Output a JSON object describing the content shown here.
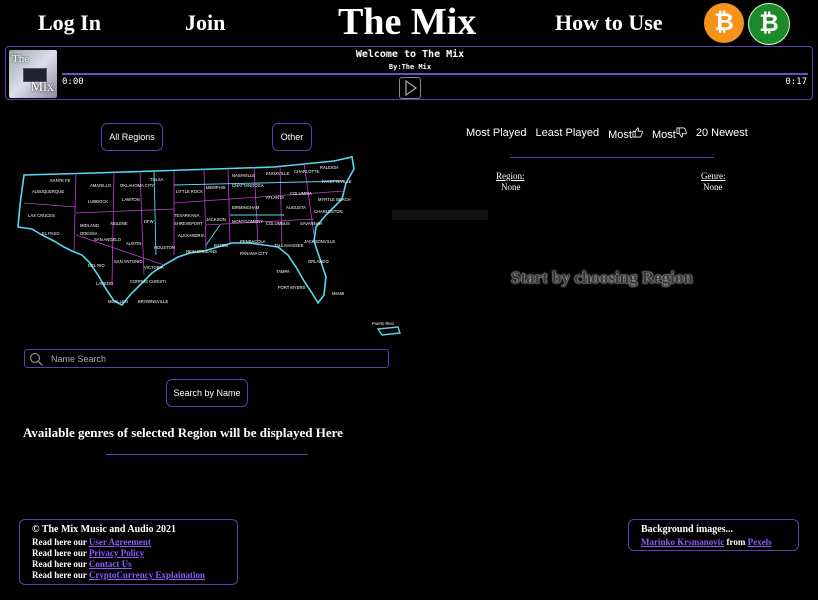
{
  "header": {
    "login": "Log In",
    "join": "Join",
    "title": "The Mix",
    "how_to_use": "How to Use",
    "bitcoin_symbol": "₿",
    "bitcoin_cash_symbol": "₿",
    "bitcoin_color": "#f7931a",
    "bitcoin_cash_color": "#1a8a2b"
  },
  "player": {
    "art_text_top": "The",
    "art_text_bottom": "Mix",
    "welcome": "Welcome to The Mix",
    "byline": "By:The Mix",
    "current_time": "0:00",
    "duration": "0:17",
    "progress": 0
  },
  "regions": {
    "all_regions": "All Regions",
    "other": "Other",
    "puerto_rico": "Puerto Rico"
  },
  "search": {
    "placeholder": "Name Search",
    "button": "Search by Name"
  },
  "genres_note": "Available genres of selected Region will be displayed Here",
  "sort": {
    "most_played": "Most Played",
    "least_played": "Least Played",
    "most_liked": "Most",
    "most_disliked": "Most",
    "newest": "20 Newest"
  },
  "selection": {
    "region_label": "Region:",
    "region_value": "None",
    "genre_label": "Genre:",
    "genre_value": "None"
  },
  "start_message": "Start by choosing Region",
  "footer": {
    "copyright": "© The Mix Music and Audio 2021",
    "read_prefix": "Read here our",
    "user_agreement": "User Agreement",
    "privacy_policy": "Privacy Policy",
    "contact_us": "Contact Us",
    "crypto": "CryptoCurrency Explaination",
    "bg_title": "Background images...",
    "bg_author": "Marinko Krsmanovic",
    "bg_from": "from",
    "bg_source": "Pexels"
  },
  "colors": {
    "accent": "#5a3fb0",
    "link": "#8b5cf6",
    "map_outline": "#5ad8f0",
    "map_region_lines": "#c040d0"
  }
}
